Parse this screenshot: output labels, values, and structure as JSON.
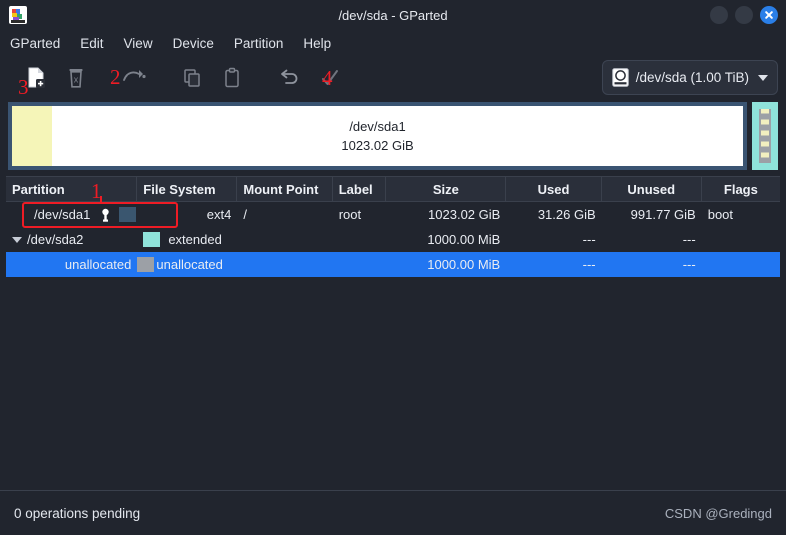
{
  "window": {
    "title": "/dev/sda - GParted",
    "app_icon": "gparted-logo-icon",
    "controls": {
      "minimize": "minimize-button",
      "maximize": "maximize-button",
      "close": "close-button"
    }
  },
  "menubar": {
    "items": [
      {
        "label": "GParted"
      },
      {
        "label": "Edit"
      },
      {
        "label": "View"
      },
      {
        "label": "Device"
      },
      {
        "label": "Partition"
      },
      {
        "label": "Help"
      }
    ]
  },
  "toolbar": {
    "buttons": [
      {
        "name": "new-partition-button",
        "icon": "new-document-icon",
        "enabled": true
      },
      {
        "name": "delete-partition-button",
        "icon": "trash-delete-icon",
        "enabled": false
      },
      {
        "name": "resize-move-button",
        "icon": "redo-arrow-icon",
        "enabled": false
      },
      {
        "name": "copy-button",
        "icon": "copy-icon",
        "enabled": false
      },
      {
        "name": "paste-button",
        "icon": "paste-clipboard-icon",
        "enabled": false
      },
      {
        "name": "undo-button",
        "icon": "undo-arrow-icon",
        "enabled": false
      },
      {
        "name": "apply-button",
        "icon": "checkmark-apply-icon",
        "enabled": false
      }
    ],
    "device_selector": {
      "icon": "hard-disk-icon",
      "value": "/dev/sda (1.00 TiB)",
      "caret": "chevron-down-icon"
    }
  },
  "diskmap": {
    "primary": {
      "name": "/dev/sda1",
      "size": "1023.02 GiB",
      "used_color": "#f5f5b8",
      "free_color": "#ffffff",
      "border_color": "#3a5472"
    },
    "extended": {
      "name": "unallocated",
      "border_color": "#8fe3da",
      "fill_color": "#9ca0a6"
    }
  },
  "table": {
    "headers": [
      "Partition",
      "File System",
      "Mount Point",
      "Label",
      "Size",
      "Used",
      "Unused",
      "Flags"
    ],
    "rows": [
      {
        "partition": "/dev/sda1",
        "icon": "key-mounted-icon",
        "swatch": "#3a566f",
        "filesystem": "ext4",
        "mount_point": "/",
        "label": "root",
        "size": "1023.02 GiB",
        "used": "31.26 GiB",
        "unused": "991.77 GiB",
        "flags": "boot",
        "selected": false
      },
      {
        "partition": "/dev/sda2",
        "expander": "triangle-down-icon",
        "swatch": "#8fe3da",
        "filesystem": "extended",
        "mount_point": "",
        "label": "",
        "size": "1000.00 MiB",
        "used": "---",
        "unused": "---",
        "flags": "",
        "selected": false
      },
      {
        "partition": "unallocated",
        "swatch": "#9ca0a6",
        "filesystem": "unallocated",
        "mount_point": "",
        "label": "",
        "size": "1000.00 MiB",
        "used": "---",
        "unused": "---",
        "flags": "",
        "selected": true
      }
    ]
  },
  "statusbar": {
    "pending": "0 operations pending",
    "watermark": "CSDN @Gredingd"
  },
  "annotations": [
    {
      "id": "annot-1",
      "label": "1",
      "target": "partition-cell-sda1"
    },
    {
      "id": "annot-2",
      "label": "2",
      "target": "resize-move-button"
    },
    {
      "id": "annot-3",
      "label": "3",
      "target": "new-partition-button"
    },
    {
      "id": "annot-4",
      "label": "4",
      "target": "apply-button"
    }
  ],
  "colors": {
    "accent_selection": "#2176f2",
    "annotation_red": "#ee1c25",
    "window_bg": "#21252e"
  }
}
